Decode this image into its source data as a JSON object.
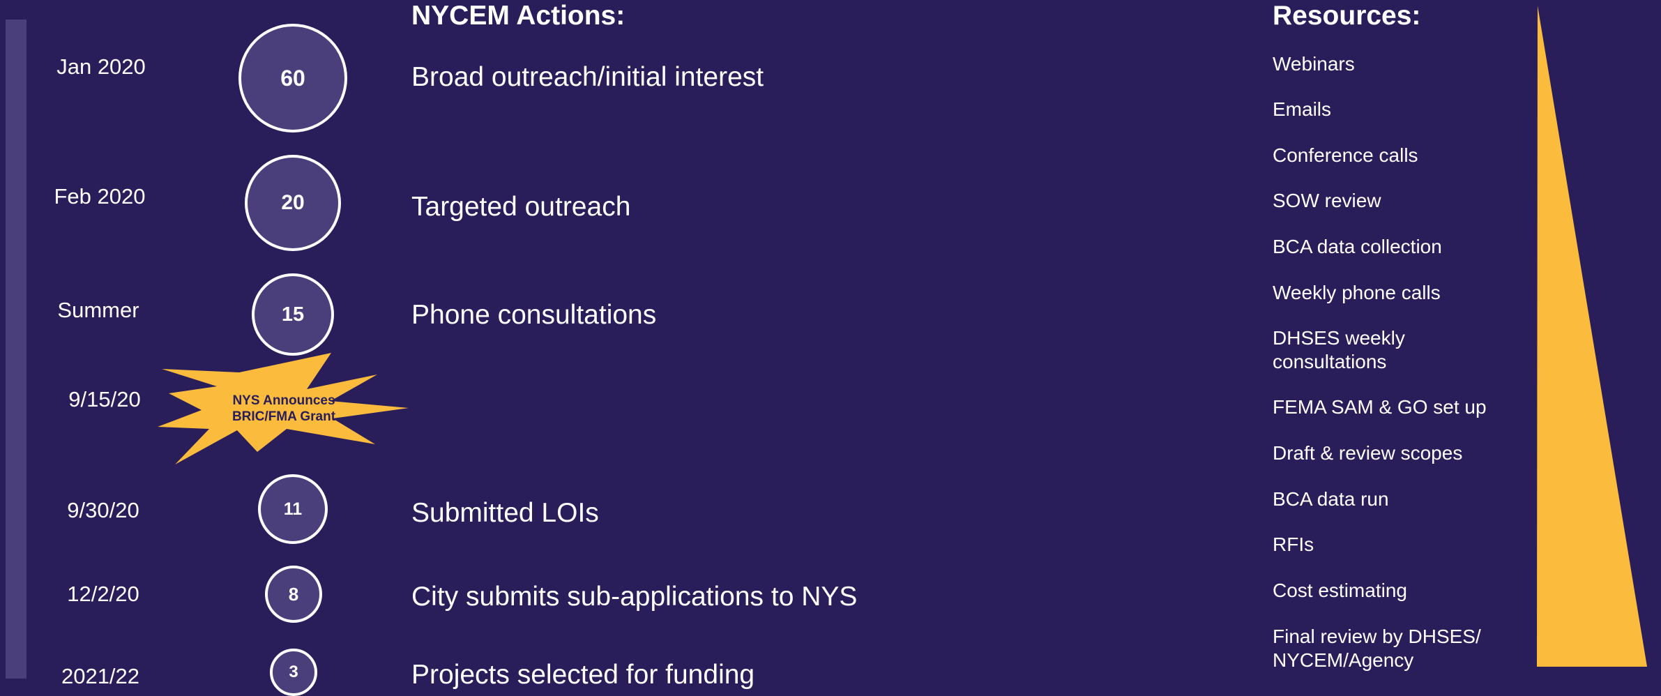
{
  "timeline": [
    {
      "date": "Jan 2020",
      "count": "60",
      "action": "Broad outreach/initial interest"
    },
    {
      "date": "Feb 2020",
      "count": "20",
      "action": "Targeted outreach"
    },
    {
      "date": "Summer",
      "count": "15",
      "action": "Phone consultations"
    },
    {
      "date": "9/15/20",
      "event_line1": "NYS Announces",
      "event_line2": "BRIC/FMA Grant"
    },
    {
      "date": "9/30/20",
      "count": "11",
      "action": "Submitted LOIs"
    },
    {
      "date": "12/2/20",
      "count": "8",
      "action": "City submits sub-applications to NYS"
    },
    {
      "date": "2021/22",
      "count": "3",
      "action": "Projects selected for funding"
    }
  ],
  "actions_heading": "NYCEM Actions:",
  "resources_heading": "Resources:",
  "resources": [
    "Webinars",
    "Emails",
    "Conference calls",
    "SOW review",
    "BCA data collection",
    "Weekly phone calls",
    "DHSES weekly consultations",
    "FEMA SAM & GO set up",
    "Draft & review scopes",
    "BCA data run",
    "RFIs",
    "Cost estimating",
    "Final review by DHSES/ NYCEM/Agency"
  ],
  "colors": {
    "background": "#291e5a",
    "circle_fill": "#4a3f7a",
    "accent": "#fbbb3c",
    "text": "#ffffff"
  }
}
